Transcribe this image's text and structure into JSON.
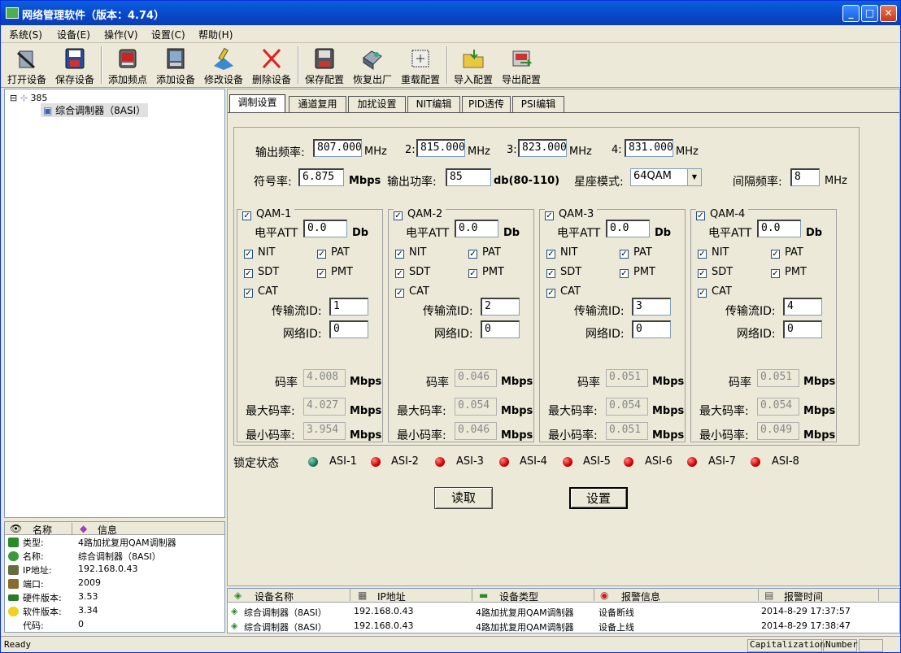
{
  "window": {
    "title": "网络管理软件（版本：4.74）"
  },
  "menu": [
    "系统(S)",
    "设备(E)",
    "操作(V)",
    "设置(C)",
    "帮助(H)"
  ],
  "toolbar": [
    {
      "label": "打开设备",
      "icon": "open-device-icon"
    },
    {
      "label": "保存设备",
      "icon": "save-device-icon"
    },
    {
      "label": "添加频点",
      "icon": "add-frequency-icon"
    },
    {
      "label": "添加设备",
      "icon": "add-device-icon"
    },
    {
      "label": "修改设备",
      "icon": "edit-device-icon"
    },
    {
      "label": "删除设备",
      "icon": "delete-device-icon"
    },
    {
      "label": "保存配置",
      "icon": "save-config-icon"
    },
    {
      "label": "恢复出厂",
      "icon": "factory-reset-icon"
    },
    {
      "label": "重载配置",
      "icon": "reload-config-icon"
    },
    {
      "label": "导入配置",
      "icon": "import-config-icon"
    },
    {
      "label": "导出配置",
      "icon": "export-config-icon"
    }
  ],
  "tree": {
    "root": "385",
    "child": "综合调制器（8ASI）"
  },
  "props": {
    "head_name": "名称",
    "head_info": "信息",
    "rows": [
      {
        "k": "类型:",
        "v": "4路加扰复用QAM调制器"
      },
      {
        "k": "名称:",
        "v": "综合调制器（8ASI）"
      },
      {
        "k": "IP地址:",
        "v": "192.168.0.43"
      },
      {
        "k": "端口:",
        "v": "2009"
      },
      {
        "k": "硬件版本:",
        "v": "3.53"
      },
      {
        "k": "软件版本:",
        "v": "3.34"
      },
      {
        "k": "代码:",
        "v": "0"
      }
    ]
  },
  "tabs": [
    "调制设置",
    "通道复用",
    "加扰设置",
    "NIT编辑",
    "PID透传",
    "PSI编辑"
  ],
  "form": {
    "out_freq_label": "输出频率:",
    "freq1": "807.000",
    "freq2_label": "2:",
    "freq2": "815.000",
    "freq3_label": "3:",
    "freq3": "823.000",
    "freq4_label": "4:",
    "freq4": "831.000",
    "mhz": "MHz",
    "symrate_label": "符号率:",
    "symrate": "6.875",
    "mbps": "Mbps",
    "power_label": "输出功率:",
    "power": "85",
    "power_unit": "db(80-110)",
    "const_label": "星座模式:",
    "const": "64QAM",
    "interval_label": "间隔频率:",
    "interval": "8"
  },
  "qam": [
    {
      "name": "QAM-1",
      "att": "0.0",
      "tsid": "1",
      "netid": "0",
      "rate": "4.008",
      "max": "4.027",
      "min": "3.954"
    },
    {
      "name": "QAM-2",
      "att": "0.0",
      "tsid": "2",
      "netid": "0",
      "rate": "0.046",
      "max": "0.054",
      "min": "0.046"
    },
    {
      "name": "QAM-3",
      "att": "0.0",
      "tsid": "3",
      "netid": "0",
      "rate": "0.051",
      "max": "0.054",
      "min": "0.051"
    },
    {
      "name": "QAM-4",
      "att": "0.0",
      "tsid": "4",
      "netid": "0",
      "rate": "0.051",
      "max": "0.054",
      "min": "0.049"
    }
  ],
  "qam_labels": {
    "att": "电平ATT",
    "db": "Db",
    "nit": "NIT",
    "pat": "PAT",
    "sdt": "SDT",
    "pmt": "PMT",
    "cat": "CAT",
    "tsid": "传输流ID:",
    "netid": "网络ID:",
    "rate": "码率",
    "max": "最大码率:",
    "min": "最小码率:"
  },
  "lock": {
    "label": "锁定状态",
    "asi": [
      {
        "name": "ASI-1",
        "status": "locked",
        "color": "#1a7a5a"
      },
      {
        "name": "ASI-2",
        "status": "unlocked",
        "color": "#d00000"
      },
      {
        "name": "ASI-3",
        "status": "unlocked",
        "color": "#d00000"
      },
      {
        "name": "ASI-4",
        "status": "unlocked",
        "color": "#d00000"
      },
      {
        "name": "ASI-5",
        "status": "unlocked",
        "color": "#d00000"
      },
      {
        "name": "ASI-6",
        "status": "unlocked",
        "color": "#d00000"
      },
      {
        "name": "ASI-7",
        "status": "unlocked",
        "color": "#d00000"
      },
      {
        "name": "ASI-8",
        "status": "unlocked",
        "color": "#d00000"
      }
    ]
  },
  "buttons": {
    "read": "读取",
    "set": "设置"
  },
  "alarms": {
    "cols": [
      "设备名称",
      "IP地址",
      "设备类型",
      "报警信息",
      "报警时间"
    ],
    "rows": [
      [
        "综合调制器（8ASI）",
        "192.168.0.43",
        "4路加扰复用QAM调制器",
        "设备断线",
        "2014-8-29 17:37:57"
      ],
      [
        "综合调制器（8ASI）",
        "192.168.0.43",
        "4路加扰复用QAM调制器",
        "设备上线",
        "2014-8-29 17:38:47"
      ]
    ]
  },
  "status": {
    "ready": "Ready",
    "cap": "Capitalization",
    "num": "Number"
  }
}
